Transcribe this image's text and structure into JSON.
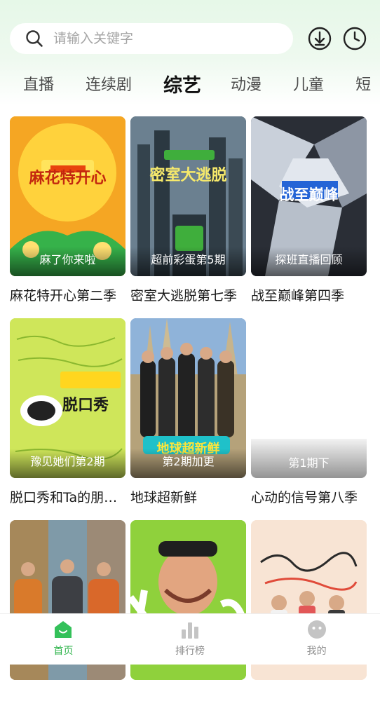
{
  "search": {
    "placeholder": "请输入关键字"
  },
  "header_icons": {
    "download": "download-icon",
    "history": "clock-icon"
  },
  "tabs": [
    {
      "label": "直播"
    },
    {
      "label": "连续剧"
    },
    {
      "label": "综艺",
      "active": true
    },
    {
      "label": "动漫"
    },
    {
      "label": "儿童"
    },
    {
      "label": "短"
    }
  ],
  "cards": [
    {
      "title": "麻花特开心第二季",
      "caption": "麻了你来啦",
      "art_text": "麻花特开心",
      "bg": "#f0a21c"
    },
    {
      "title": "密室大逃脱第七季",
      "caption": "超前彩蛋第5期",
      "art_text": "密室大逃脱",
      "bg": "#3a4a55"
    },
    {
      "title": "战至巅峰第四季",
      "caption": "探班直播回顾",
      "art_text": "战至巅峰",
      "bg": "#9aa4b3"
    },
    {
      "title": "脱口秀和Ta的朋友们",
      "caption": "豫见她们第2期",
      "art_text": "脱口秀",
      "bg": "#c5e04a"
    },
    {
      "title": "地球超新鲜",
      "caption": "第2期加更",
      "art_text": "地球超新鲜",
      "bg": "#3c6fb8"
    },
    {
      "title": "心动的信号第八季",
      "caption": "第1期下",
      "art_text": "",
      "bg": "#ffffff"
    },
    {
      "title": "",
      "caption": "",
      "art_text": "",
      "bg": "#b78a5a"
    },
    {
      "title": "",
      "caption": "",
      "art_text": "",
      "bg": "#8fd13c"
    },
    {
      "title": "",
      "caption": "",
      "art_text": "",
      "bg": "#f7e3d2"
    }
  ],
  "bottom_nav": [
    {
      "label": "首页",
      "icon": "home-icon",
      "active": true
    },
    {
      "label": "排行榜",
      "icon": "bar-chart-icon",
      "active": false
    },
    {
      "label": "我的",
      "icon": "face-icon",
      "active": false
    }
  ],
  "colors": {
    "accent": "#2db34a",
    "inactive": "#bdbdbd"
  }
}
